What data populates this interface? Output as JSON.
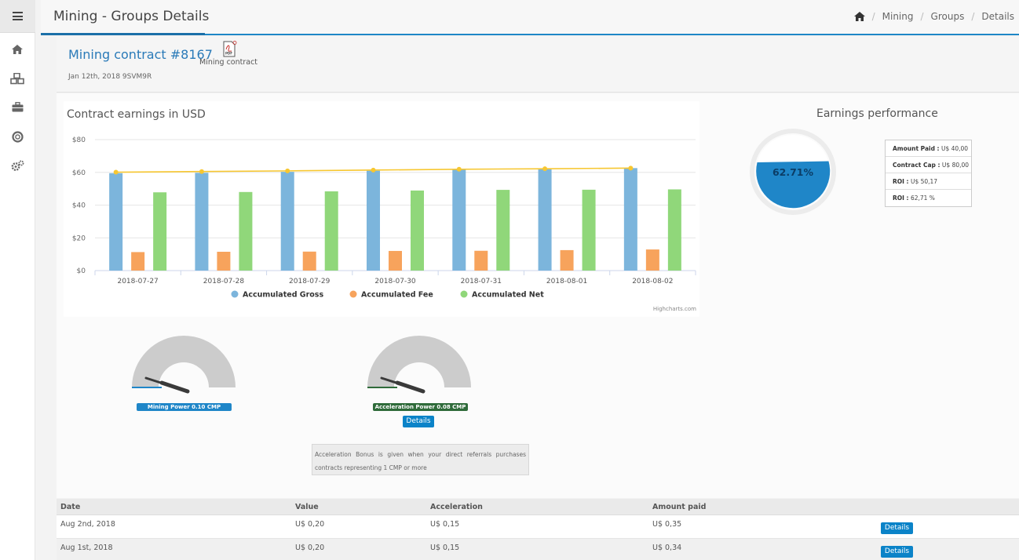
{
  "header": {
    "title": "Mining - Groups Details",
    "breadcrumbs": [
      "Mining",
      "Groups",
      "Details"
    ]
  },
  "contract": {
    "title": "Mining contract #8167",
    "date": "Jan 12th, 2018 9SVM9R",
    "pdf_label": "Mining contract"
  },
  "earnings_chart": {
    "title": "Contract earnings in USD",
    "credits": "Highcharts.com"
  },
  "chart_data": {
    "type": "bar",
    "categories": [
      "2018-07-27",
      "2018-07-28",
      "2018-07-29",
      "2018-07-30",
      "2018-07-31",
      "2018-08-01",
      "2018-08-02"
    ],
    "series": [
      {
        "name": "Accumulated Gross",
        "type": "bar",
        "color": "#7cb5dc",
        "values": [
          59.5,
          59.7,
          60.3,
          61.0,
          61.6,
          62.0,
          62.6
        ]
      },
      {
        "name": "Accumulated Fee",
        "type": "bar",
        "color": "#f7a35c",
        "values": [
          11.3,
          11.5,
          11.6,
          12.0,
          12.1,
          12.5,
          12.9
        ]
      },
      {
        "name": "Accumulated Net",
        "type": "bar",
        "color": "#90d77a",
        "values": [
          47.8,
          48.0,
          48.4,
          48.9,
          49.3,
          49.4,
          49.6
        ]
      },
      {
        "name": "",
        "type": "line",
        "color": "#f7c731",
        "values": [
          60.1,
          60.5,
          60.9,
          61.4,
          61.9,
          62.2,
          62.6
        ]
      }
    ],
    "ylim": [
      0,
      80
    ],
    "yticks": [
      "$0",
      "$20",
      "$40",
      "$60",
      "$80"
    ],
    "grid": true,
    "legend_position": "bottom"
  },
  "performance": {
    "title": "Earnings performance",
    "percent_label": "62.71%",
    "fill_fraction": 0.6271,
    "color": "#1f86c8",
    "rows": [
      {
        "label": "Amount Paid :",
        "value": "U$ 40,00"
      },
      {
        "label": "Contract Cap :",
        "value": "U$ 80,00"
      },
      {
        "label": "ROI :",
        "value": "U$ 50,17"
      },
      {
        "label": "ROI :",
        "value": "62,71 %"
      }
    ]
  },
  "gauges": {
    "mining": {
      "label": "Mining Power 0.10 CMP",
      "fraction": 0.0,
      "color": "#1f86c8"
    },
    "acceleration": {
      "label": "Acceleration Power 0.08 CMP",
      "fraction": 0.0,
      "color": "#2f6b3a"
    },
    "details_label": "Details",
    "note": "Acceleration Bonus is given when your direct referrals purchases contracts representing 1 CMP or more"
  },
  "table": {
    "headers": [
      "Date",
      "Value",
      "Acceleration",
      "Amount paid"
    ],
    "rows": [
      {
        "date": "Aug 2nd, 2018",
        "value": "U$ 0,20",
        "acceleration": "U$ 0,15",
        "amount": "U$ 0,35",
        "button": "Details"
      },
      {
        "date": "Aug 1st, 2018",
        "value": "U$ 0,20",
        "acceleration": "U$ 0,15",
        "amount": "U$ 0,34",
        "button": "Details"
      }
    ]
  }
}
